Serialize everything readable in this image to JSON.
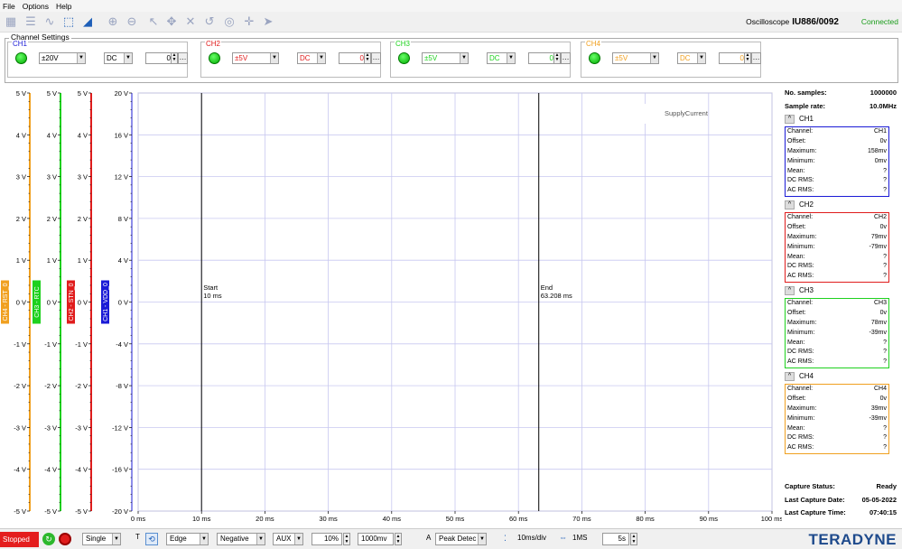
{
  "menu": [
    "File",
    "Options",
    "Help"
  ],
  "header": {
    "scope_label": "Oscilloscope",
    "device": "IU886/0092",
    "status": "Connected"
  },
  "channel_settings": {
    "title": "Channel Settings",
    "channels": [
      {
        "name": "CH1",
        "range": "±20V",
        "coupling": "DC",
        "offset": "0%",
        "color": "#1b1bd6"
      },
      {
        "name": "CH2",
        "range": "±5V",
        "coupling": "DC",
        "offset": "0%",
        "color": "#e01c1c"
      },
      {
        "name": "CH3",
        "range": "±5V",
        "coupling": "DC",
        "offset": "0%",
        "color": "#1ed11e"
      },
      {
        "name": "CH4",
        "range": "±5V",
        "coupling": "DC",
        "offset": "0%",
        "color": "#f0a020"
      }
    ]
  },
  "axes": [
    {
      "label": "CH4 - RST_0",
      "color": "#f0a020",
      "ticks": [
        "5 V",
        "4 V",
        "3 V",
        "2 V",
        "1 V",
        "0 V",
        "-1 V",
        "-2 V",
        "-3 V",
        "-4 V",
        "-5 V"
      ]
    },
    {
      "label": "CH3 - RTC",
      "color": "#1ed11e",
      "ticks": [
        "5 V",
        "4 V",
        "3 V",
        "2 V",
        "1 V",
        "0 V",
        "-1 V",
        "-2 V",
        "-3 V",
        "-4 V",
        "-5 V"
      ]
    },
    {
      "label": "CH2 - STN_0",
      "color": "#e01c1c",
      "ticks": [
        "5 V",
        "4 V",
        "3 V",
        "2 V",
        "1 V",
        "0 V",
        "-1 V",
        "-2 V",
        "-3 V",
        "-4 V",
        "-5 V"
      ]
    },
    {
      "label": "CH1 - VDD_0",
      "color": "#1b1bd6",
      "ticks": [
        "20 V",
        "16 V",
        "12 V",
        "8 V",
        "4 V",
        "0 V",
        "-4 V",
        "-8 V",
        "-12 V",
        "-16 V",
        "-20 V"
      ]
    }
  ],
  "plot": {
    "x_ticks": [
      "0 ms",
      "10 ms",
      "20 ms",
      "30 ms",
      "40 ms",
      "50 ms",
      "60 ms",
      "70 ms",
      "80 ms",
      "90 ms",
      "100 ms"
    ],
    "x_range_ms": [
      0,
      100
    ],
    "start_marker": {
      "label": "Start",
      "value": "10 ms",
      "ms": 10
    },
    "end_marker": {
      "label": "End",
      "value": "63.208 ms",
      "ms": 63.208
    },
    "trace_label": "SupplyCurrent",
    "grid_color": "#c8c8f0"
  },
  "stats": {
    "samples_label": "No. samples:",
    "samples": "1000000",
    "rate_label": "Sample rate:",
    "rate": "10.0MHz",
    "panels": [
      {
        "name": "CH1",
        "color": "#1b1bd6",
        "rows": [
          [
            "Channel:",
            "CH1"
          ],
          [
            "Offset:",
            "0v"
          ],
          [
            "Maximum:",
            "158mv"
          ],
          [
            "Minimum:",
            "0mv"
          ],
          [
            "Mean:",
            "?"
          ],
          [
            "DC RMS:",
            "?"
          ],
          [
            "AC RMS:",
            "?"
          ]
        ]
      },
      {
        "name": "CH2",
        "color": "#e01c1c",
        "rows": [
          [
            "Channel:",
            "CH2"
          ],
          [
            "Offset:",
            "0v"
          ],
          [
            "Maximum:",
            "79mv"
          ],
          [
            "Minimum:",
            "-79mv"
          ],
          [
            "Mean:",
            "?"
          ],
          [
            "DC RMS:",
            "?"
          ],
          [
            "AC RMS:",
            "?"
          ]
        ]
      },
      {
        "name": "CH3",
        "color": "#1ed11e",
        "rows": [
          [
            "Channel:",
            "CH3"
          ],
          [
            "Offset:",
            "0v"
          ],
          [
            "Maximum:",
            "78mv"
          ],
          [
            "Minimum:",
            "-39mv"
          ],
          [
            "Mean:",
            "?"
          ],
          [
            "DC RMS:",
            "?"
          ],
          [
            "AC RMS:",
            "?"
          ]
        ]
      },
      {
        "name": "CH4",
        "color": "#f0a020",
        "rows": [
          [
            "Channel:",
            "CH4"
          ],
          [
            "Offset:",
            "0v"
          ],
          [
            "Maximum:",
            "39mv"
          ],
          [
            "Minimum:",
            "-39mv"
          ],
          [
            "Mean:",
            "?"
          ],
          [
            "DC RMS:",
            "?"
          ],
          [
            "AC RMS:",
            "?"
          ]
        ]
      }
    ],
    "capture_status_label": "Capture Status:",
    "capture_status": "Ready",
    "last_date_label": "Last Capture Date:",
    "last_date": "05-05-2022",
    "last_time_label": "Last Capture Time:",
    "last_time": "07:40:15"
  },
  "bottom": {
    "status": "Stopped",
    "mode": "Single",
    "trigger_type": "Edge",
    "edge": "Negative",
    "source": "AUX",
    "level": "10%",
    "level_v": "1000mv",
    "acq_label": "A",
    "acq_mode": "Peak Detec",
    "timebase": "10ms/div",
    "samples": "1MS",
    "duration": "5s",
    "brand": "TERADYNE"
  }
}
